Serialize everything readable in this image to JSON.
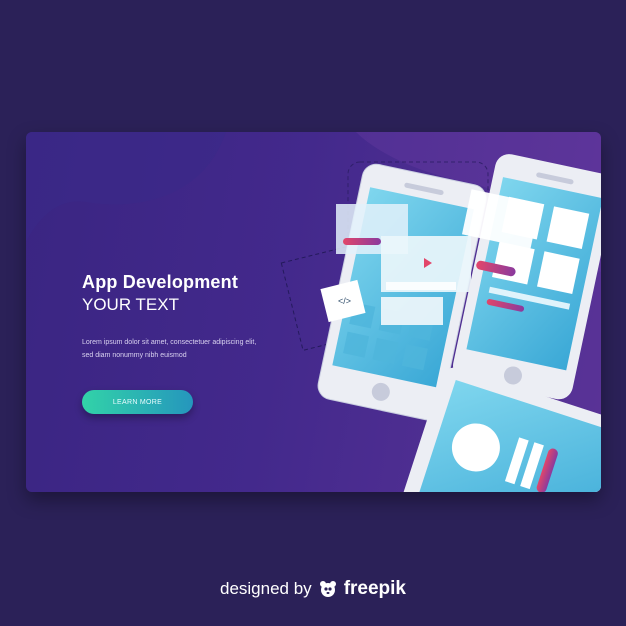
{
  "hero": {
    "title": "App Development",
    "subtitle": "YOUR TEXT",
    "body": "Lorem ipsum dolor sit amet, consectetuer adipiscing elit, sed diam nonummy nibh euismod",
    "cta_label": "LEARN MORE"
  },
  "mockup": {
    "code_badge": "</>"
  },
  "footer": {
    "prefix": "designed by",
    "brand": "freepik",
    "logo_icon": "freepik-logo-icon"
  },
  "colors": {
    "page_bg": "#2b2158",
    "card_bg": "#43298c",
    "cta_start": "#32d3a8",
    "cta_end": "#2596bd",
    "screen": "#5ec8e6"
  }
}
